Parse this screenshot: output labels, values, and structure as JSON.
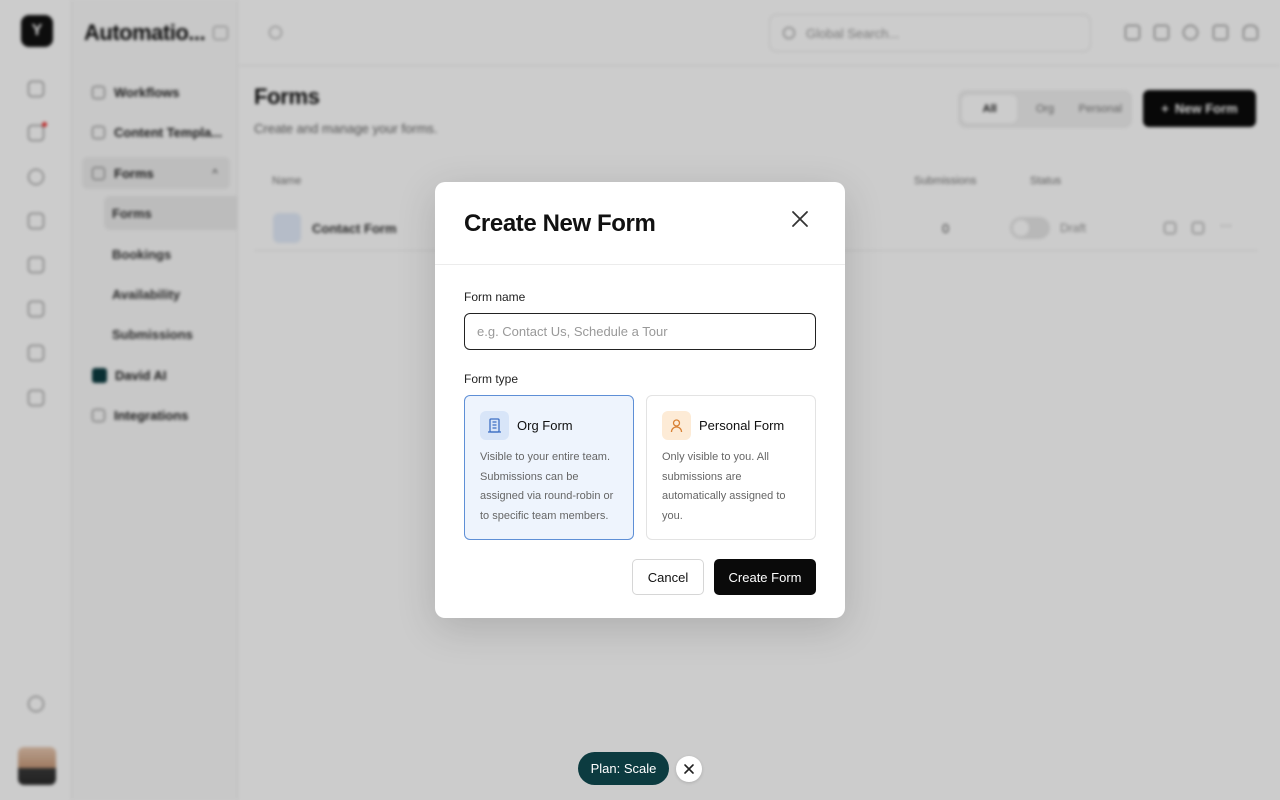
{
  "app": {
    "logo_glyph": "Y",
    "workspace_title": "Automatio..."
  },
  "rail": {
    "icons": [
      "grid-icon",
      "bell-icon",
      "globe-icon",
      "shield-icon",
      "home-icon",
      "calendar-icon",
      "phone-icon",
      "chart-icon",
      "settings-icon"
    ],
    "notification_color": "#e33333"
  },
  "sidebar": {
    "items": [
      {
        "label": "Workflows",
        "icon": "phone-icon"
      },
      {
        "label": "Content Templa...",
        "icon": "document-icon"
      },
      {
        "label": "Forms",
        "icon": "form-icon"
      },
      {
        "label": "David AI",
        "icon": "ai-icon"
      },
      {
        "label": "Integrations",
        "icon": "integrations-icon"
      }
    ],
    "forms_children": [
      "Forms",
      "Bookings",
      "Availability",
      "Submissions"
    ]
  },
  "topbar": {
    "search_placeholder": "Global Search..."
  },
  "main": {
    "title": "Forms",
    "subtitle": "Create and manage your forms.",
    "filter_tabs": [
      "All",
      "Org",
      "Personal"
    ],
    "new_button": "New Form",
    "columns": {
      "name": "Name",
      "submissions": "Submissions",
      "status": "Status"
    },
    "rows": [
      {
        "name": "Contact Form",
        "submissions": "0",
        "status": "Draft"
      }
    ]
  },
  "modal": {
    "title": "Create New Form",
    "name_label": "Form name",
    "name_placeholder": "e.g. Contact Us, Schedule a Tour",
    "name_value": "",
    "type_label": "Form type",
    "types": [
      {
        "title": "Org Form",
        "description": "Visible to your entire team. Submissions can be assigned via round-robin or to specific team members.",
        "icon": "building-icon",
        "selected": true
      },
      {
        "title": "Personal Form",
        "description": "Only visible to you. All submissions are automatically assigned to you.",
        "icon": "user-icon",
        "selected": false
      }
    ],
    "cancel_label": "Cancel",
    "create_label": "Create Form"
  },
  "plan_pill": {
    "label": "Plan: Scale",
    "color": "#0c3b40"
  },
  "colors": {
    "primary_button": "#0a0a0a",
    "selected_card_border": "#5e8fd6",
    "selected_card_bg": "#eef4fd"
  }
}
